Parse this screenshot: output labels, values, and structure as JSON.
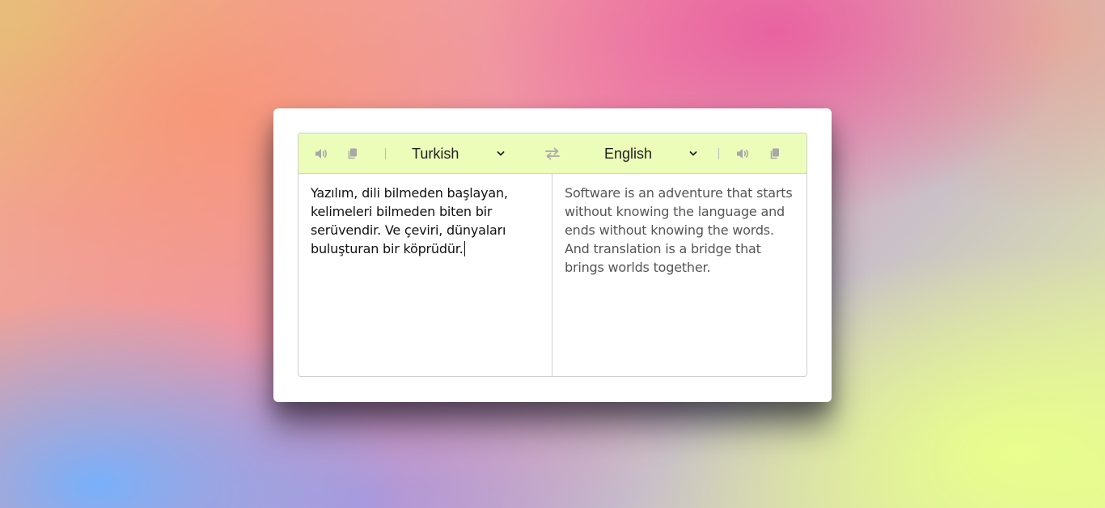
{
  "colors": {
    "toolbar_bg": "#ebfdb9",
    "source_text": "#111111",
    "target_text": "#555555",
    "icon": "#a8a8a8"
  },
  "source": {
    "language": "Turkish",
    "text": "Yazılım, dili bilmeden başlayan, kelimeleri bilmeden biten bir serüvendir. Ve çeviri, dünyaları buluşturan bir köprüdür.",
    "speak_icon": "speaker-icon",
    "copy_icon": "copy-icon"
  },
  "swap_icon": "swap-arrows-icon",
  "target": {
    "language": "English",
    "text": "Software is an adventure that starts without knowing the language and ends without knowing the words. And translation is a bridge that brings worlds together.",
    "speak_icon": "speaker-icon",
    "copy_icon": "copy-icon"
  }
}
